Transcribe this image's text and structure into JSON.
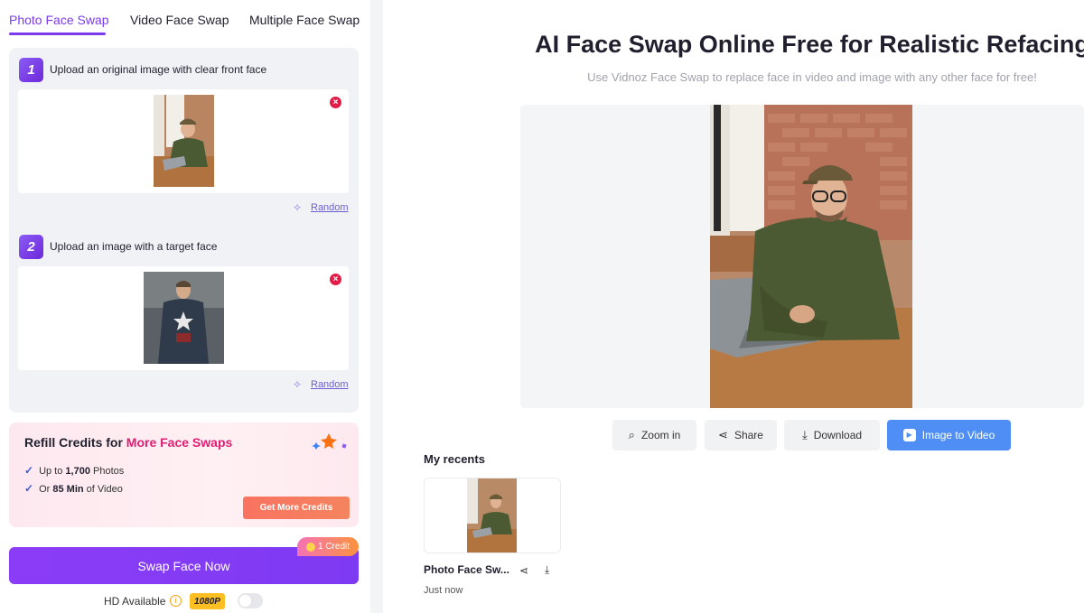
{
  "tabs": [
    {
      "label": "Photo Face Swap",
      "active": true
    },
    {
      "label": "Video Face Swap",
      "active": false
    },
    {
      "label": "Multiple Face Swap",
      "active": false
    }
  ],
  "steps": [
    {
      "number": "1",
      "label": "Upload an original image with clear front face",
      "random_label": "Random",
      "image": "man-at-laptop-photo"
    },
    {
      "number": "2",
      "label": "Upload an image with a target face",
      "random_label": "Random",
      "image": "superhero-photo"
    }
  ],
  "credits": {
    "title_prefix": "Refill Credits for",
    "title_highlight": "More Face Swaps",
    "line1_prefix": "Up to",
    "line1_bold": "1,700",
    "line1_suffix": "Photos",
    "line2_prefix": "Or",
    "line2_bold": "85 Min",
    "line2_suffix": "of Video",
    "button_label": "Get More Credits",
    "accent": "#e11d72"
  },
  "swap": {
    "button_label": "Swap Face Now",
    "credit_badge": "1 Credit",
    "hd_label": "HD Available",
    "hd_badge": "1080P",
    "hd_enabled": false
  },
  "main": {
    "title": "AI Face Swap Online Free for Realistic Refacing",
    "subtitle": "Use Vidnoz Face Swap to replace face in video and image with any other face for free!"
  },
  "actions": [
    {
      "label": "Zoom in",
      "icon": "search-icon"
    },
    {
      "label": "Share",
      "icon": "share-icon"
    },
    {
      "label": "Download",
      "icon": "download-icon"
    },
    {
      "label": "Image to Video",
      "icon": "play-icon"
    }
  ],
  "recents": {
    "title": "My recents",
    "items": [
      {
        "name": "Photo Face Sw...",
        "time": "Just now"
      }
    ]
  },
  "colors": {
    "brand_purple": "#7c3aed",
    "primary_blue": "#4f8ff5",
    "danger": "#e11d48"
  }
}
